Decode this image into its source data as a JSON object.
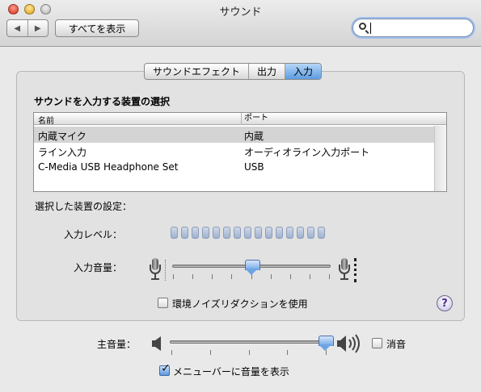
{
  "window": {
    "title": "サウンド"
  },
  "toolbar": {
    "back_label": "◀",
    "forward_label": "▶",
    "show_all_label": "すべてを表示",
    "search_value": ""
  },
  "tabs": [
    {
      "label": "サウンドエフェクト",
      "selected": false
    },
    {
      "label": "出力",
      "selected": false
    },
    {
      "label": "入力",
      "selected": true
    }
  ],
  "input_pane": {
    "section_title": "サウンドを入力する装置の選択",
    "columns": [
      "名前",
      "ポート"
    ],
    "devices": [
      {
        "name": "内蔵マイク",
        "port": "内蔵",
        "selected": true
      },
      {
        "name": "ライン入力",
        "port": "オーディオライン入力ポート",
        "selected": false
      },
      {
        "name": "C-Media USB Headphone Set",
        "port": "USB",
        "selected": false
      }
    ],
    "settings_label": "選択した装置の設定：",
    "level_label": "入力レベル：",
    "level_segments": 15,
    "level_active": 0,
    "volume_label": "入力音量：",
    "input_volume": 0.5,
    "noise_reduction_label": "環境ノイズリダクションを使用",
    "noise_reduction_checked": false,
    "help_label": "?"
  },
  "master": {
    "volume_label": "主音量：",
    "volume": 0.98,
    "mute_label": "消音",
    "mute_checked": false,
    "show_in_menubar_label": "メニューバーに音量を表示",
    "show_in_menubar_checked": true
  },
  "colors": {
    "selection_tab": "#5c9ce4",
    "selected_row": "#d4d4d4",
    "help_purple": "#4a2a8a"
  }
}
